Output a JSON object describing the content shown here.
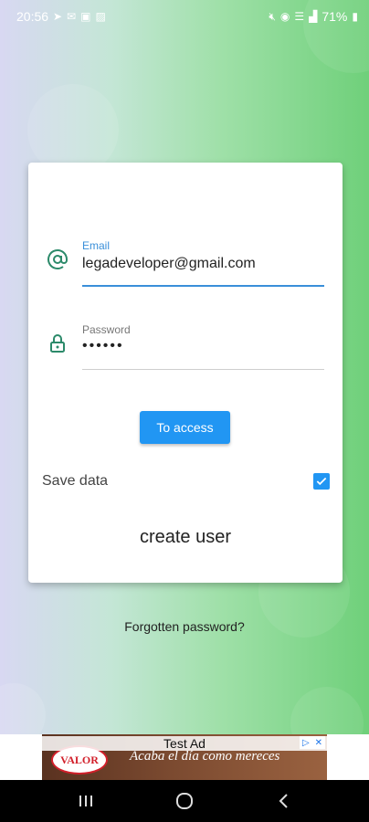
{
  "status": {
    "time": "20:56",
    "battery": "71%",
    "left_icons": [
      "telegram-icon",
      "mail-icon",
      "screenshot-icon",
      "image-icon"
    ],
    "right_icons": [
      "mute-icon",
      "hotspot-icon",
      "wifi-icon",
      "signal-icon",
      "battery-icon"
    ]
  },
  "login": {
    "email_label": "Email",
    "email_value": "legadeveloper@gmail.com",
    "password_label": "Password",
    "password_value": "••••••",
    "access_label": "To access",
    "save_label": "Save data",
    "save_checked": true,
    "create_user_label": "create user",
    "forgot_label": "Forgotten password?"
  },
  "ad": {
    "title": "Test Ad",
    "brand": "VALOR",
    "text": "Acaba el día como mereces"
  },
  "navbar": {
    "buttons": [
      "recents",
      "home",
      "back"
    ]
  },
  "colors": {
    "accent": "#2196f3",
    "icon": "#2c8a6a",
    "gradient_left": "#d8d8f2",
    "gradient_right": "#6fd07a"
  }
}
